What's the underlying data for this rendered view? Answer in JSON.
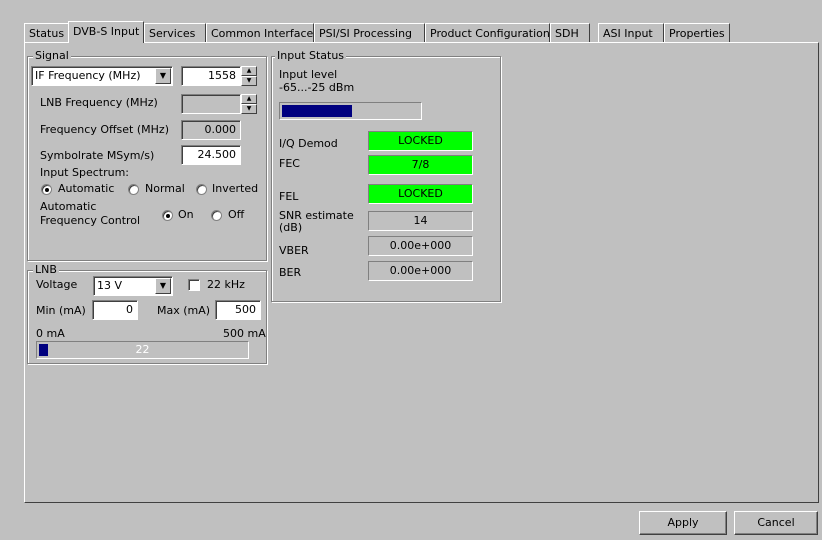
{
  "tabs": [
    "Status",
    "DVB-S Input",
    "Services",
    "Common Interface",
    "PSI/SI Processing",
    "Product Configuration",
    "SDH",
    "ASI Input",
    "Properties"
  ],
  "signal": {
    "legend": "Signal",
    "if_select": "IF Frequency (MHz)",
    "if_value": "1558",
    "lnb_freq_label": "LNB Frequency (MHz)",
    "lnb_freq_value": "",
    "freq_offset_label": "Frequency Offset (MHz)",
    "freq_offset_value": "0.000",
    "symbolrate_label": "Symbolrate MSym/s)",
    "symbolrate_value": "24.500",
    "spectrum_label": "Input Spectrum:",
    "spectrum_opts": [
      "Automatic",
      "Normal",
      "Inverted"
    ],
    "afc_label_1": "Automatic",
    "afc_label_2": "Frequency Control",
    "afc_opts": [
      "On",
      "Off"
    ]
  },
  "lnb": {
    "legend": "LNB",
    "voltage_label": "Voltage",
    "voltage_value": "13 V",
    "khz_label": "22 kHz",
    "min_label": "Min (mA)",
    "min_value": "0",
    "max_label": "Max (mA)",
    "max_value": "500",
    "scale_min": "0 mA",
    "scale_max": "500 mA",
    "current_value": "22",
    "current_fraction": 0.044
  },
  "input_status": {
    "legend": "Input Status",
    "level_label_1": "Input level",
    "level_label_2": "-65...-25 dBm",
    "level_fraction": 0.51,
    "rows": [
      {
        "label": "I/Q Demod",
        "value": "LOCKED",
        "color": "#00ff00"
      },
      {
        "label": "FEC",
        "value": "7/8",
        "color": "#00ff00"
      },
      {
        "label": "FEL",
        "value": "LOCKED",
        "color": "#00ff00"
      },
      {
        "label": "SNR estimate (dB)",
        "value": "14",
        "color": "#c0c0c0"
      },
      {
        "label": "VBER",
        "value": "0.00e+000",
        "color": "#c0c0c0"
      },
      {
        "label": "BER",
        "value": "0.00e+000",
        "color": "#c0c0c0"
      }
    ]
  },
  "buttons": {
    "apply": "Apply",
    "cancel": "Cancel"
  },
  "colors": {
    "locked": "#00ff00",
    "progress": "#00007f"
  }
}
